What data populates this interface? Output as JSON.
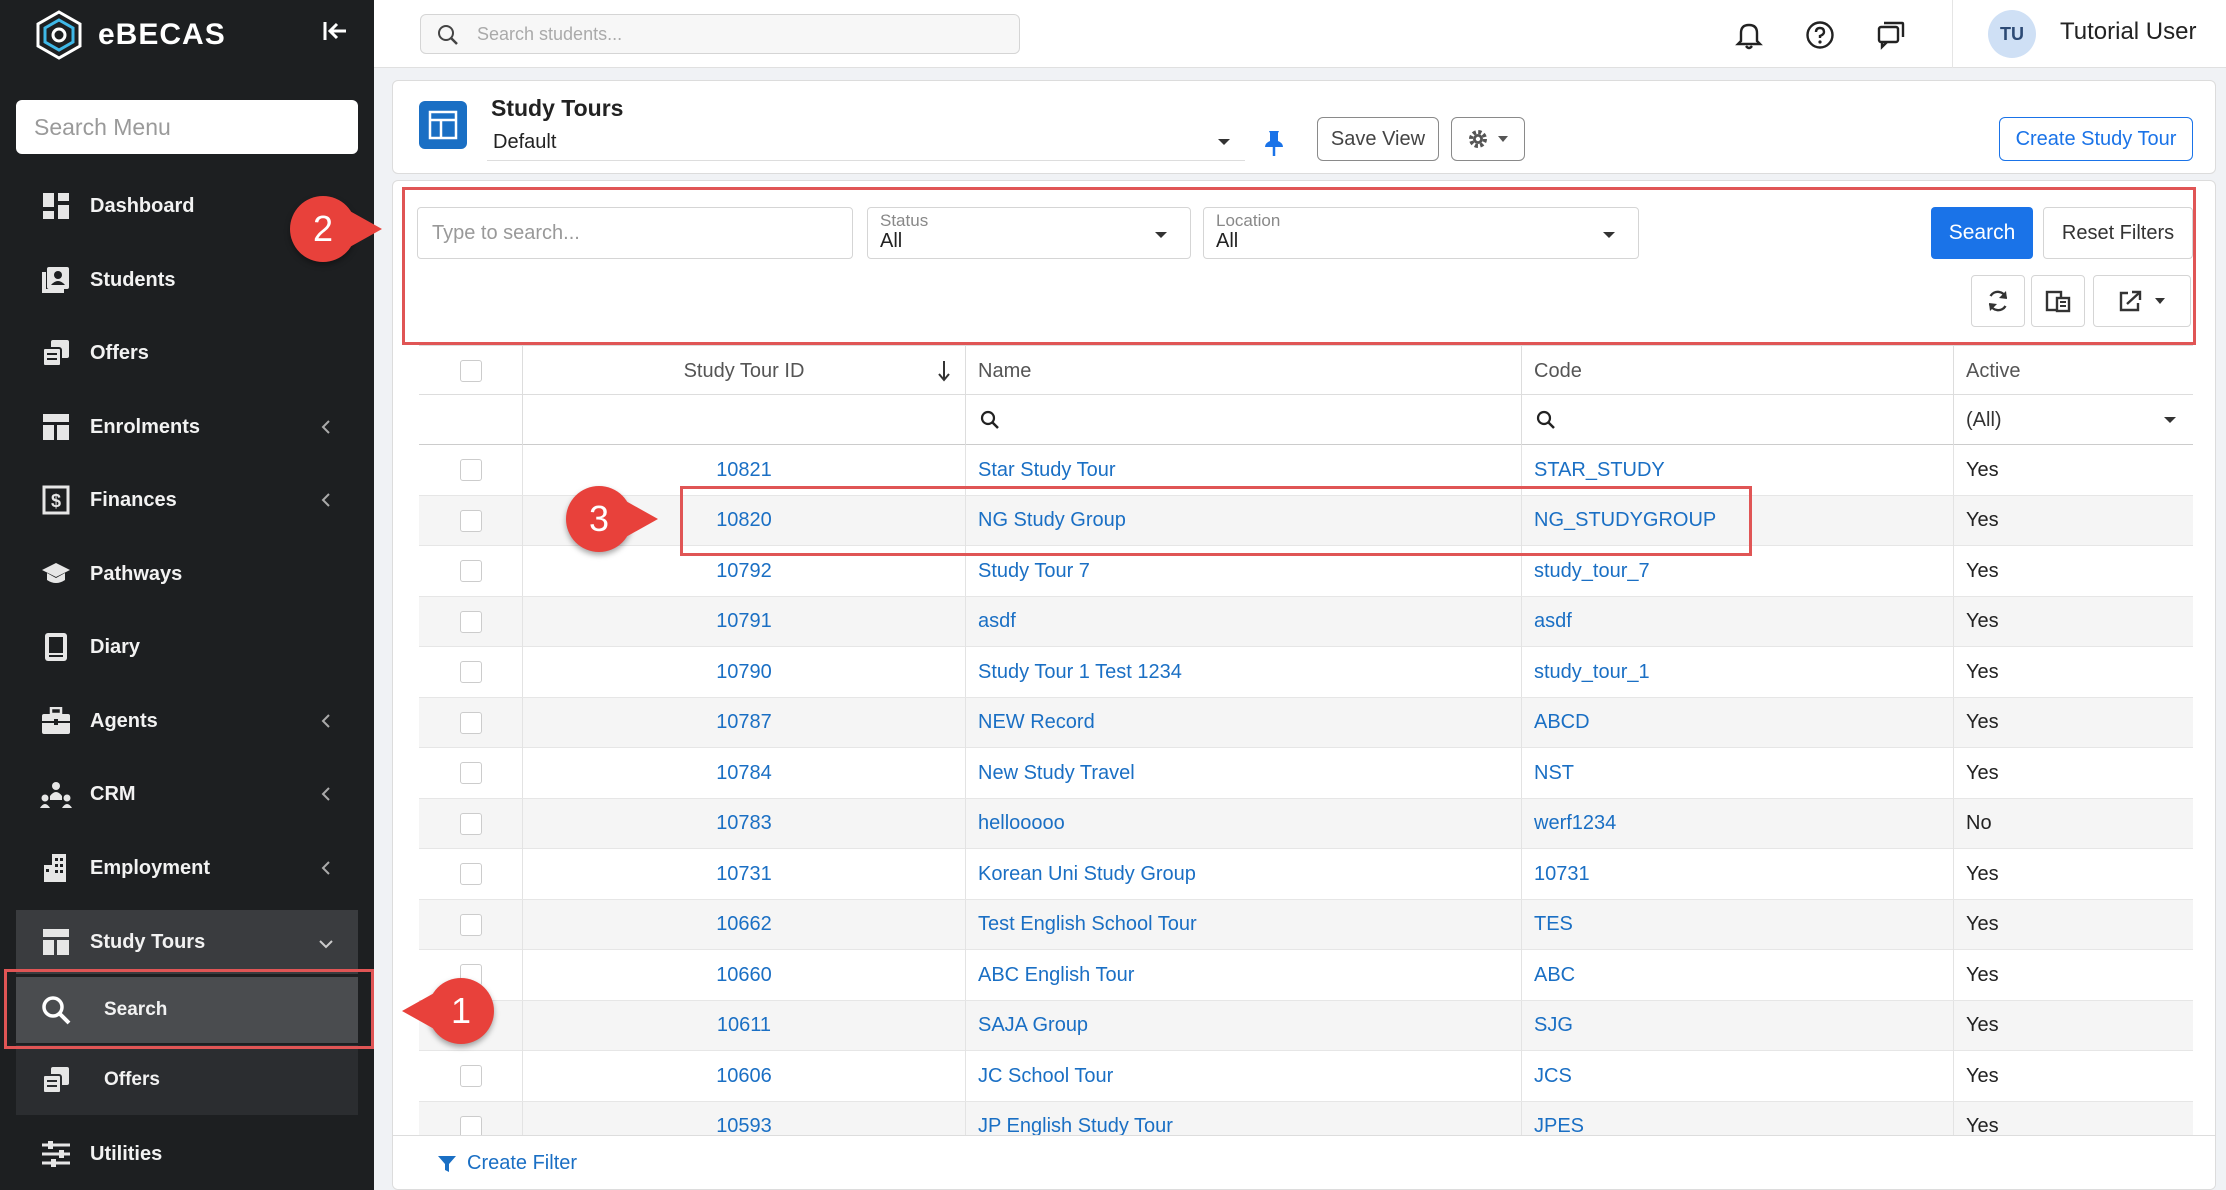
{
  "app": {
    "name": "eBECAS"
  },
  "sidebar": {
    "search_placeholder": "Search Menu",
    "items": [
      {
        "label": "Dashboard",
        "icon": "dashboard-icon"
      },
      {
        "label": "Students",
        "icon": "students-icon"
      },
      {
        "label": "Offers",
        "icon": "offers-icon"
      },
      {
        "label": "Enrolments",
        "icon": "enrolments-icon"
      },
      {
        "label": "Finances",
        "icon": "finances-icon"
      },
      {
        "label": "Pathways",
        "icon": "pathways-icon"
      },
      {
        "label": "Diary",
        "icon": "diary-icon"
      },
      {
        "label": "Agents",
        "icon": "agents-icon"
      },
      {
        "label": "CRM",
        "icon": "crm-icon"
      },
      {
        "label": "Employment",
        "icon": "employment-icon"
      },
      {
        "label": "Study Tours",
        "icon": "study-tours-icon"
      },
      {
        "label": "Utilities",
        "icon": "utilities-icon"
      }
    ],
    "study_tours_sub": [
      {
        "label": "Search",
        "icon": "search-icon"
      },
      {
        "label": "Offers",
        "icon": "offers-icon"
      }
    ]
  },
  "topbar": {
    "search_placeholder": "Search students...",
    "user_initials": "TU",
    "user_name": "Tutorial User"
  },
  "header": {
    "title": "Study Tours",
    "view": "Default",
    "save_view": "Save View",
    "create_button": "Create Study Tour"
  },
  "filters": {
    "search_placeholder": "Type to search...",
    "status": {
      "label": "Status",
      "value": "All"
    },
    "location": {
      "label": "Location",
      "value": "All"
    },
    "search_button": "Search",
    "reset_button": "Reset Filters"
  },
  "table": {
    "columns": [
      "Study Tour ID",
      "Name",
      "Code",
      "Active"
    ],
    "active_filter": "(All)",
    "rows": [
      {
        "id": "10821",
        "name": "Star Study Tour",
        "code": "STAR_STUDY",
        "active": "Yes"
      },
      {
        "id": "10820",
        "name": "NG Study Group",
        "code": "NG_STUDYGROUP",
        "active": "Yes"
      },
      {
        "id": "10792",
        "name": "Study Tour 7",
        "code": "study_tour_7",
        "active": "Yes"
      },
      {
        "id": "10791",
        "name": "asdf",
        "code": "asdf",
        "active": "Yes"
      },
      {
        "id": "10790",
        "name": "Study Tour 1 Test 1234",
        "code": "study_tour_1",
        "active": "Yes"
      },
      {
        "id": "10787",
        "name": "NEW Record",
        "code": "ABCD",
        "active": "Yes"
      },
      {
        "id": "10784",
        "name": "New Study Travel",
        "code": "NST",
        "active": "Yes"
      },
      {
        "id": "10783",
        "name": "hellooooo",
        "code": "werf1234",
        "active": "No"
      },
      {
        "id": "10731",
        "name": "Korean Uni Study Group",
        "code": "10731",
        "active": "Yes"
      },
      {
        "id": "10662",
        "name": "Test English School Tour",
        "code": "TES",
        "active": "Yes"
      },
      {
        "id": "10660",
        "name": "ABC English Tour",
        "code": "ABC",
        "active": "Yes"
      },
      {
        "id": "10611",
        "name": "SAJA Group",
        "code": "SJG",
        "active": "Yes"
      },
      {
        "id": "10606",
        "name": "JC School Tour",
        "code": "JCS",
        "active": "Yes"
      },
      {
        "id": "10593",
        "name": "JP English Study Tour",
        "code": "JPES",
        "active": "Yes"
      }
    ]
  },
  "footer": {
    "create_filter": "Create Filter"
  },
  "callouts": [
    "1",
    "2",
    "3"
  ],
  "colors": {
    "accent": "#1a73e8",
    "sidebar": "#1d1f21",
    "callout": "#e8413b"
  }
}
